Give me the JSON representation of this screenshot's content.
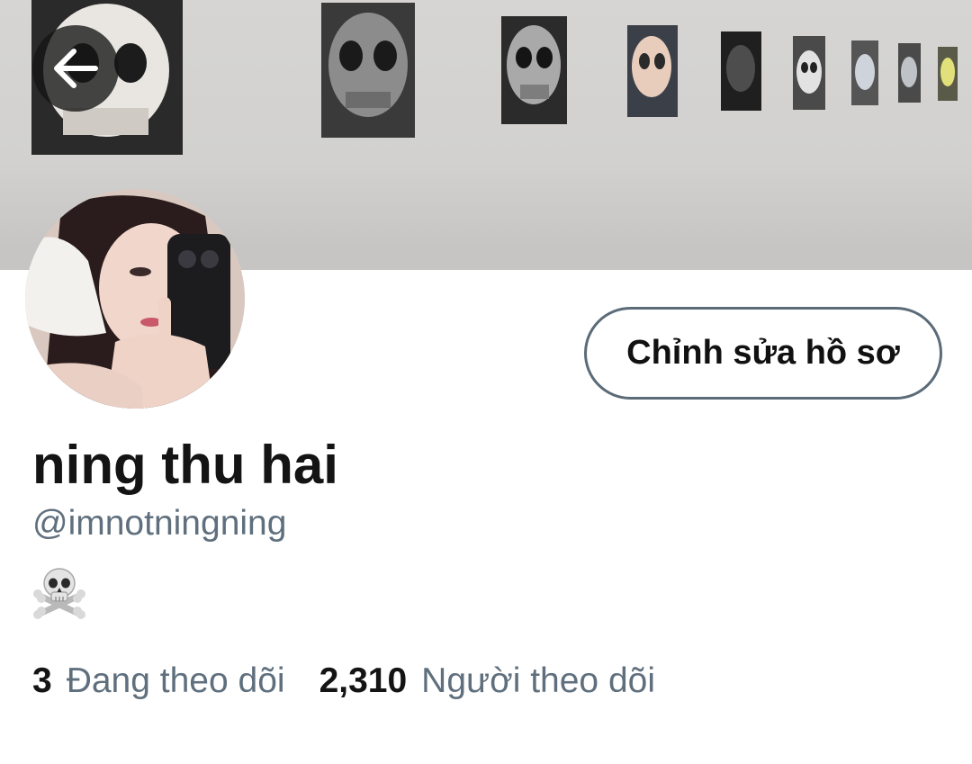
{
  "header": {
    "back_icon": "arrow-left-icon",
    "banner": "profile-banner-gallery-wall"
  },
  "profile": {
    "display_name": "ning thu hai",
    "handle": "@imnotningning",
    "bio_emoji": "☠️",
    "edit_button_label": "Chỉnh sửa hồ sơ"
  },
  "stats": {
    "following_count": "3",
    "following_label": "Đang theo dõi",
    "followers_count": "2,310",
    "followers_label": "Người theo dõi"
  },
  "colors": {
    "primary_text": "#141414",
    "secondary_text": "#5f6f7d",
    "button_border": "#5b6b78",
    "back_button_bg": "#141414"
  }
}
